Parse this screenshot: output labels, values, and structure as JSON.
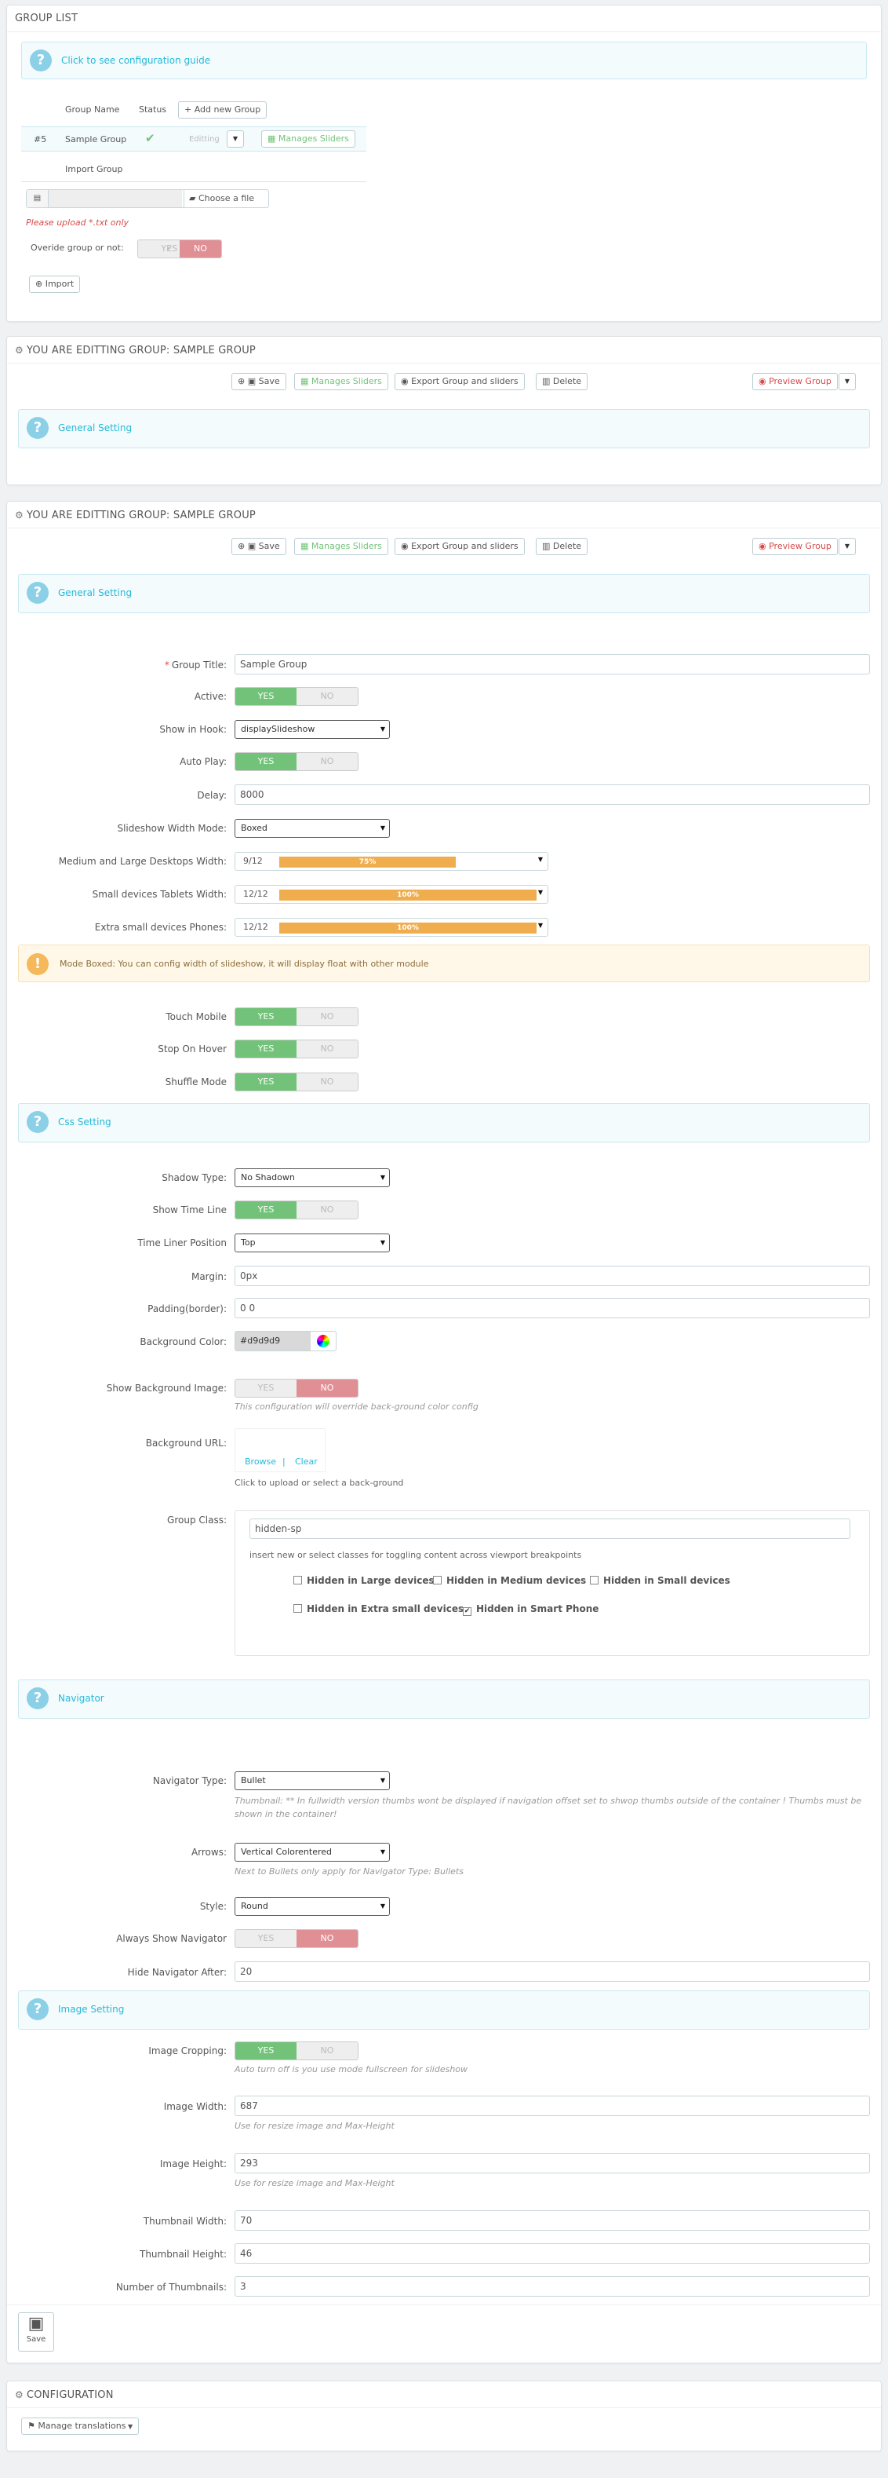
{
  "group_list": {
    "title": "GROUP LIST",
    "guide_link": "Click to see configuration guide",
    "col_group_name": "Group Name",
    "col_status": "Status",
    "add_new_group": "Add new Group",
    "row": {
      "id": "#5",
      "name": "Sample Group",
      "action": "Editting",
      "manages_sliders": "Manages Sliders"
    },
    "import_group_label": "Import Group",
    "choose_file": "Choose a file",
    "upload_hint": "Please upload *.txt only",
    "override_label": "Overide group or not:",
    "override_yes": "YES",
    "override_no": "NO",
    "import_button": "Import"
  },
  "edit_panel_1": {
    "title": "YOU ARE EDITTING GROUP: SAMPLE GROUP",
    "toolbar": {
      "save": "Save",
      "manages_sliders": "Manages Sliders",
      "export": "Export Group and sliders",
      "delete": "Delete",
      "preview": "Preview Group"
    },
    "general_setting": "General Setting"
  },
  "edit_panel_2": {
    "title": "YOU ARE EDITTING GROUP: SAMPLE GROUP",
    "toolbar": {
      "save": "Save",
      "manages_sliders": "Manages Sliders",
      "export": "Export Group and sliders",
      "delete": "Delete",
      "preview": "Preview Group"
    },
    "general": {
      "section": "General Setting",
      "group_title_label": "Group Title:",
      "group_title_value": "Sample Group",
      "active_label": "Active:",
      "show_in_hook_label": "Show in Hook:",
      "show_in_hook_value": "displaySlideshow",
      "auto_play_label": "Auto Play:",
      "delay_label": "Delay:",
      "delay_value": "8000",
      "width_mode_label": "Slideshow Width Mode:",
      "width_mode_value": "Boxed",
      "desktop_width_label": "Medium and Large Desktops Width:",
      "desktop_width_value": "9/12",
      "desktop_width_percent": "75%",
      "desktop_width_fraction": 0.75,
      "tablet_width_label": "Small devices Tablets Width:",
      "tablet_width_value": "12/12",
      "tablet_width_percent": "100%",
      "tablet_width_fraction": 1.0,
      "phone_width_label": "Extra small devices Phones:",
      "phone_width_value": "12/12",
      "phone_width_percent": "100%",
      "phone_width_fraction": 1.0,
      "boxed_notice": "Mode Boxed: You can config width of slideshow, it will display float with other module",
      "touch_mobile_label": "Touch Mobile",
      "stop_on_hover_label": "Stop On Hover",
      "shuffle_mode_label": "Shuffle Mode"
    },
    "css": {
      "section": "Css Setting",
      "shadow_type_label": "Shadow Type:",
      "shadow_type_value": "No Shadown",
      "show_time_line_label": "Show Time Line",
      "time_liner_position_label": "Time Liner Position",
      "time_liner_position_value": "Top",
      "margin_label": "Margin:",
      "margin_value": "0px",
      "padding_label": "Padding(border):",
      "padding_value": "0 0",
      "bg_color_label": "Background Color:",
      "bg_color_value": "#d9d9d9",
      "show_bg_image_label": "Show Background Image:",
      "show_bg_image_help": "This configuration will override back-ground color config",
      "bg_url_label": "Background URL:",
      "browse": "Browse",
      "separator": "|",
      "clear": "Clear",
      "bg_url_help": "Click to upload or select a back-ground",
      "group_class_label": "Group Class:",
      "group_class_value": "hidden-sp",
      "group_class_help": "insert new or select classes for toggling content across viewport breakpoints",
      "hidden_large": "Hidden in Large devices",
      "hidden_medium": "Hidden in Medium devices",
      "hidden_small": "Hidden in Small devices",
      "hidden_xsmall": "Hidden in Extra small devices",
      "hidden_smartphone": "Hidden in Smart Phone",
      "checkmark": "✔"
    },
    "navigator": {
      "section": "Navigator",
      "type_label": "Navigator Type:",
      "type_value": "Bullet",
      "type_help": "Thumbnail: ** In fullwidth version thumbs wont be displayed if navigation offset set to shwop thumbs outside of the container ! Thumbs must be shown in the container!",
      "arrows_label": "Arrows:",
      "arrows_value": "Vertical Colorentered",
      "arrows_help": "Next to Bullets only apply for Navigator Type: Bullets",
      "style_label": "Style:",
      "style_value": "Round",
      "always_show_label": "Always Show Navigator",
      "hide_after_label": "Hide Navigator After:",
      "hide_after_value": "20"
    },
    "image": {
      "section": "Image Setting",
      "cropping_label": "Image Cropping:",
      "cropping_help": "Auto turn off is you use mode fullscreen for slideshow",
      "width_label": "Image Width:",
      "width_value": "687",
      "width_help": "Use for resize image and Max-Height",
      "height_label": "Image Height:",
      "height_value": "293",
      "height_help": "Use for resize image and Max-Height",
      "thumb_width_label": "Thumbnail Width:",
      "thumb_width_value": "70",
      "thumb_height_label": "Thumbnail Height:",
      "thumb_height_value": "46",
      "num_thumbs_label": "Number of Thumbnails:",
      "num_thumbs_value": "3"
    },
    "save_label": "Save"
  },
  "switch_text": {
    "yes": "YES",
    "no": "NO"
  },
  "configuration": {
    "title": "CONFIGURATION",
    "manage_translations": "Manage translations"
  },
  "colors": {
    "accent": "#25b9d7",
    "yes": "#72c279",
    "no": "#e08f95",
    "bar": "#f0ad4e"
  }
}
